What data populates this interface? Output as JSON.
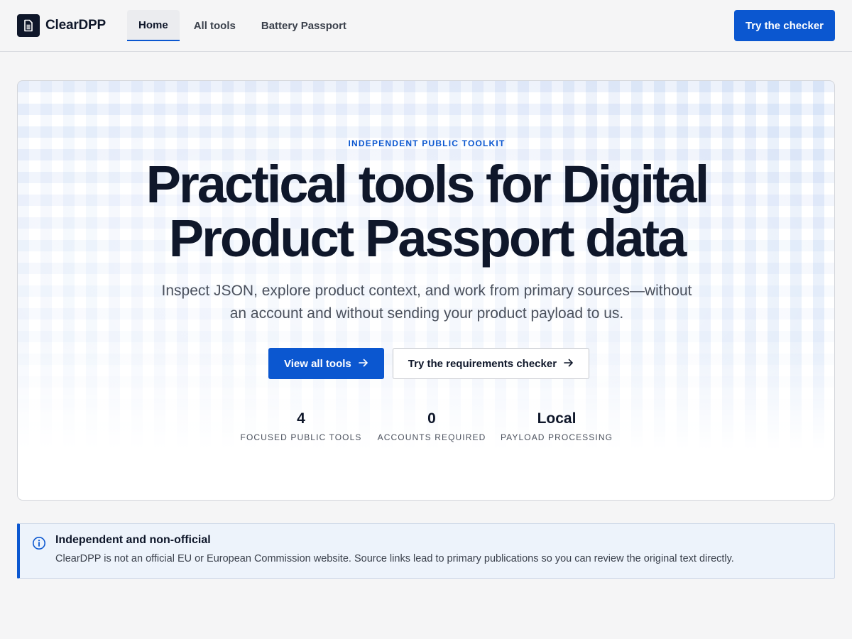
{
  "brand": {
    "name": "ClearDPP",
    "logo_icon": "document-icon"
  },
  "nav": {
    "items": [
      {
        "label": "Home",
        "active": true
      },
      {
        "label": "All tools",
        "active": false
      },
      {
        "label": "Battery Passport",
        "active": false
      }
    ],
    "cta_label": "Try the checker"
  },
  "hero": {
    "eyebrow": "INDEPENDENT PUBLIC TOOLKIT",
    "title": "Practical tools for Digital Product Passport data",
    "subtitle": "Inspect JSON, explore product context, and work from primary sources—without an account and without sending your product payload to us.",
    "primary_button": "View all tools",
    "secondary_button": "Try the requirements checker",
    "arrow_icon": "arrow-right-icon",
    "stats": [
      {
        "value": "4",
        "label": "FOCUSED PUBLIC TOOLS"
      },
      {
        "value": "0",
        "label": "ACCOUNTS REQUIRED"
      },
      {
        "value": "Local",
        "label": "PAYLOAD PROCESSING"
      }
    ]
  },
  "notice": {
    "icon": "info-icon",
    "title": "Independent and non-official",
    "body": "ClearDPP is not an official EU or European Commission website. Source links lead to primary publications so you can review the original text directly."
  },
  "colors": {
    "accent": "#0b57d0",
    "text": "#0f172a",
    "muted": "#4a505c",
    "page_bg": "#f5f5f6",
    "notice_bg": "#edf3fb"
  }
}
